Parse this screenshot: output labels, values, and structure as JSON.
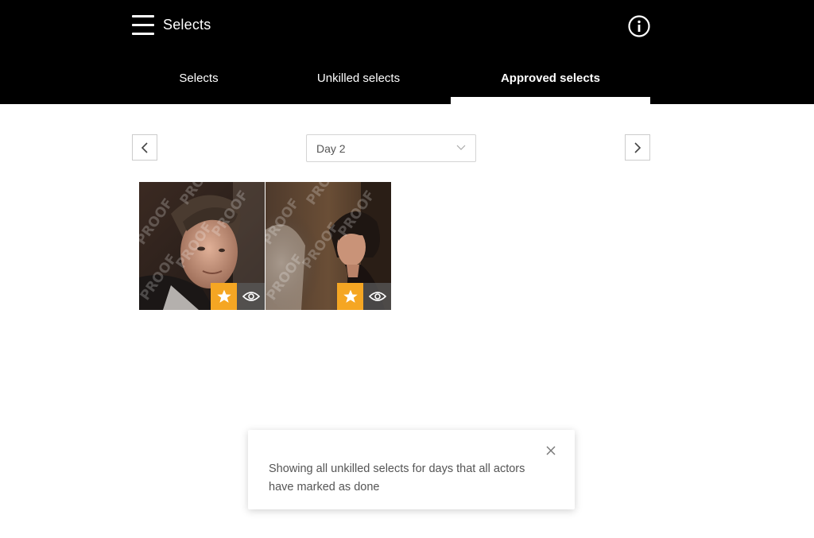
{
  "header": {
    "title": "Selects",
    "menu_icon": "hamburger-icon",
    "info_icon": "info-icon"
  },
  "tabs": [
    {
      "label": "Selects",
      "active": false
    },
    {
      "label": "Unkilled selects",
      "active": false
    },
    {
      "label": "Approved selects",
      "active": true
    }
  ],
  "day_selector": {
    "value": "Day 2",
    "prev_icon": "chevron-left-icon",
    "next_icon": "chevron-right-icon"
  },
  "photos": [
    {
      "watermark": "PROOF",
      "starred": true,
      "subject": "man-portrait"
    },
    {
      "watermark": "PROOF",
      "starred": true,
      "subject": "woman-portrait"
    }
  ],
  "toast": {
    "message": "Showing all unkilled selects for days that all actors have marked as done"
  },
  "colors": {
    "header_bg": "#000000",
    "accent_star": "#f5a623"
  }
}
